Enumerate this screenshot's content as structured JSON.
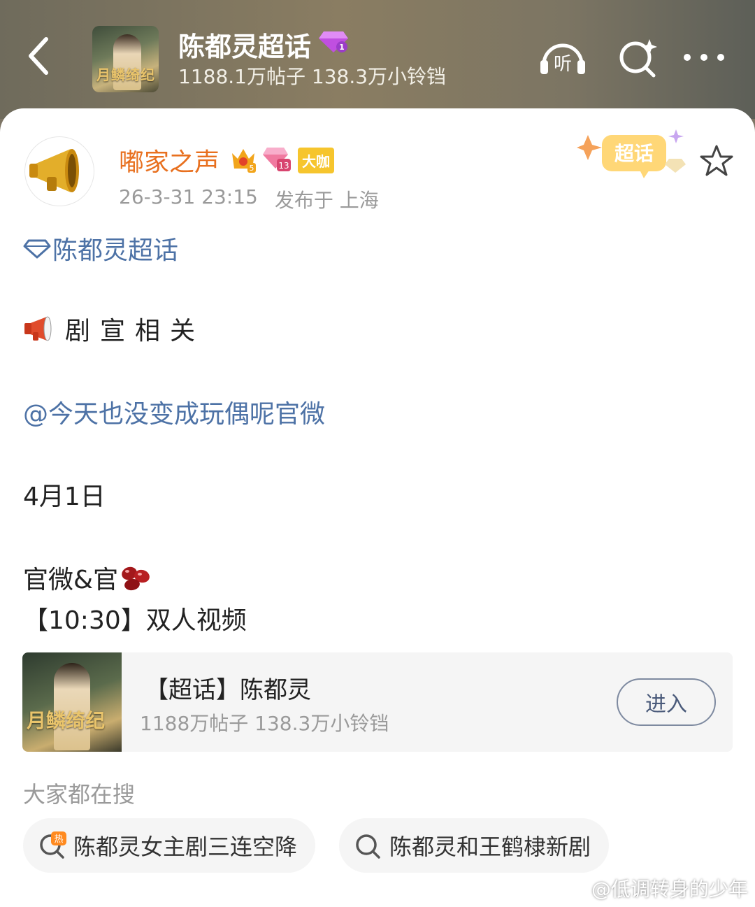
{
  "header": {
    "title": "陈都灵超话",
    "stats": "1188.1万帖子 138.3万小铃铛",
    "cover_text": "月鳞绮纪",
    "listen_label": "听"
  },
  "post": {
    "author": "嘟家之声",
    "level_badge": "5",
    "fan_badge": "13",
    "role_badge": "大咖",
    "time": "26-3-31 23:15",
    "location": "发布于 上海",
    "chaohua_badge": "超话",
    "topic_link": "陈都灵超话",
    "section_tag": "剧宣相关",
    "mention": "@今天也没变成玩偶呢官微",
    "date_line": "4月1日",
    "line_official": "官微&官",
    "line_video": "【10:30】双人视频"
  },
  "topic_card": {
    "title": "【超话】陈都灵",
    "stats": "1188万帖子 138.3万小铃铛",
    "button": "进入",
    "cover_text": "月鳞绮纪"
  },
  "search": {
    "label": "大家都在搜",
    "chips": [
      {
        "text": "陈都灵女主剧三连空降",
        "icon": "hot-search-icon"
      },
      {
        "text": "陈都灵和王鹤棣新剧",
        "icon": "search-icon"
      }
    ]
  },
  "watermark": "@低调转身的少年",
  "colors": {
    "author": "#e8701f",
    "link": "#4d72a6",
    "badge": "#f6c52d"
  }
}
